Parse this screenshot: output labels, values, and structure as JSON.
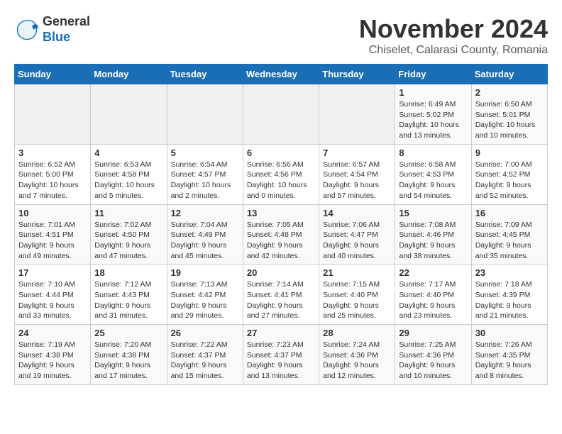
{
  "header": {
    "logo_line1": "General",
    "logo_line2": "Blue",
    "month_year": "November 2024",
    "location": "Chiselet, Calarasi County, Romania"
  },
  "weekdays": [
    "Sunday",
    "Monday",
    "Tuesday",
    "Wednesday",
    "Thursday",
    "Friday",
    "Saturday"
  ],
  "weeks": [
    [
      {
        "day": "",
        "info": ""
      },
      {
        "day": "",
        "info": ""
      },
      {
        "day": "",
        "info": ""
      },
      {
        "day": "",
        "info": ""
      },
      {
        "day": "",
        "info": ""
      },
      {
        "day": "1",
        "info": "Sunrise: 6:49 AM\nSunset: 5:02 PM\nDaylight: 10 hours and 13 minutes."
      },
      {
        "day": "2",
        "info": "Sunrise: 6:50 AM\nSunset: 5:01 PM\nDaylight: 10 hours and 10 minutes."
      }
    ],
    [
      {
        "day": "3",
        "info": "Sunrise: 6:52 AM\nSunset: 5:00 PM\nDaylight: 10 hours and 7 minutes."
      },
      {
        "day": "4",
        "info": "Sunrise: 6:53 AM\nSunset: 4:58 PM\nDaylight: 10 hours and 5 minutes."
      },
      {
        "day": "5",
        "info": "Sunrise: 6:54 AM\nSunset: 4:57 PM\nDaylight: 10 hours and 2 minutes."
      },
      {
        "day": "6",
        "info": "Sunrise: 6:56 AM\nSunset: 4:56 PM\nDaylight: 10 hours and 0 minutes."
      },
      {
        "day": "7",
        "info": "Sunrise: 6:57 AM\nSunset: 4:54 PM\nDaylight: 9 hours and 57 minutes."
      },
      {
        "day": "8",
        "info": "Sunrise: 6:58 AM\nSunset: 4:53 PM\nDaylight: 9 hours and 54 minutes."
      },
      {
        "day": "9",
        "info": "Sunrise: 7:00 AM\nSunset: 4:52 PM\nDaylight: 9 hours and 52 minutes."
      }
    ],
    [
      {
        "day": "10",
        "info": "Sunrise: 7:01 AM\nSunset: 4:51 PM\nDaylight: 9 hours and 49 minutes."
      },
      {
        "day": "11",
        "info": "Sunrise: 7:02 AM\nSunset: 4:50 PM\nDaylight: 9 hours and 47 minutes."
      },
      {
        "day": "12",
        "info": "Sunrise: 7:04 AM\nSunset: 4:49 PM\nDaylight: 9 hours and 45 minutes."
      },
      {
        "day": "13",
        "info": "Sunrise: 7:05 AM\nSunset: 4:48 PM\nDaylight: 9 hours and 42 minutes."
      },
      {
        "day": "14",
        "info": "Sunrise: 7:06 AM\nSunset: 4:47 PM\nDaylight: 9 hours and 40 minutes."
      },
      {
        "day": "15",
        "info": "Sunrise: 7:08 AM\nSunset: 4:46 PM\nDaylight: 9 hours and 38 minutes."
      },
      {
        "day": "16",
        "info": "Sunrise: 7:09 AM\nSunset: 4:45 PM\nDaylight: 9 hours and 35 minutes."
      }
    ],
    [
      {
        "day": "17",
        "info": "Sunrise: 7:10 AM\nSunset: 4:44 PM\nDaylight: 9 hours and 33 minutes."
      },
      {
        "day": "18",
        "info": "Sunrise: 7:12 AM\nSunset: 4:43 PM\nDaylight: 9 hours and 31 minutes."
      },
      {
        "day": "19",
        "info": "Sunrise: 7:13 AM\nSunset: 4:42 PM\nDaylight: 9 hours and 29 minutes."
      },
      {
        "day": "20",
        "info": "Sunrise: 7:14 AM\nSunset: 4:41 PM\nDaylight: 9 hours and 27 minutes."
      },
      {
        "day": "21",
        "info": "Sunrise: 7:15 AM\nSunset: 4:40 PM\nDaylight: 9 hours and 25 minutes."
      },
      {
        "day": "22",
        "info": "Sunrise: 7:17 AM\nSunset: 4:40 PM\nDaylight: 9 hours and 23 minutes."
      },
      {
        "day": "23",
        "info": "Sunrise: 7:18 AM\nSunset: 4:39 PM\nDaylight: 9 hours and 21 minutes."
      }
    ],
    [
      {
        "day": "24",
        "info": "Sunrise: 7:19 AM\nSunset: 4:38 PM\nDaylight: 9 hours and 19 minutes."
      },
      {
        "day": "25",
        "info": "Sunrise: 7:20 AM\nSunset: 4:38 PM\nDaylight: 9 hours and 17 minutes."
      },
      {
        "day": "26",
        "info": "Sunrise: 7:22 AM\nSunset: 4:37 PM\nDaylight: 9 hours and 15 minutes."
      },
      {
        "day": "27",
        "info": "Sunrise: 7:23 AM\nSunset: 4:37 PM\nDaylight: 9 hours and 13 minutes."
      },
      {
        "day": "28",
        "info": "Sunrise: 7:24 AM\nSunset: 4:36 PM\nDaylight: 9 hours and 12 minutes."
      },
      {
        "day": "29",
        "info": "Sunrise: 7:25 AM\nSunset: 4:36 PM\nDaylight: 9 hours and 10 minutes."
      },
      {
        "day": "30",
        "info": "Sunrise: 7:26 AM\nSunset: 4:35 PM\nDaylight: 9 hours and 8 minutes."
      }
    ]
  ]
}
